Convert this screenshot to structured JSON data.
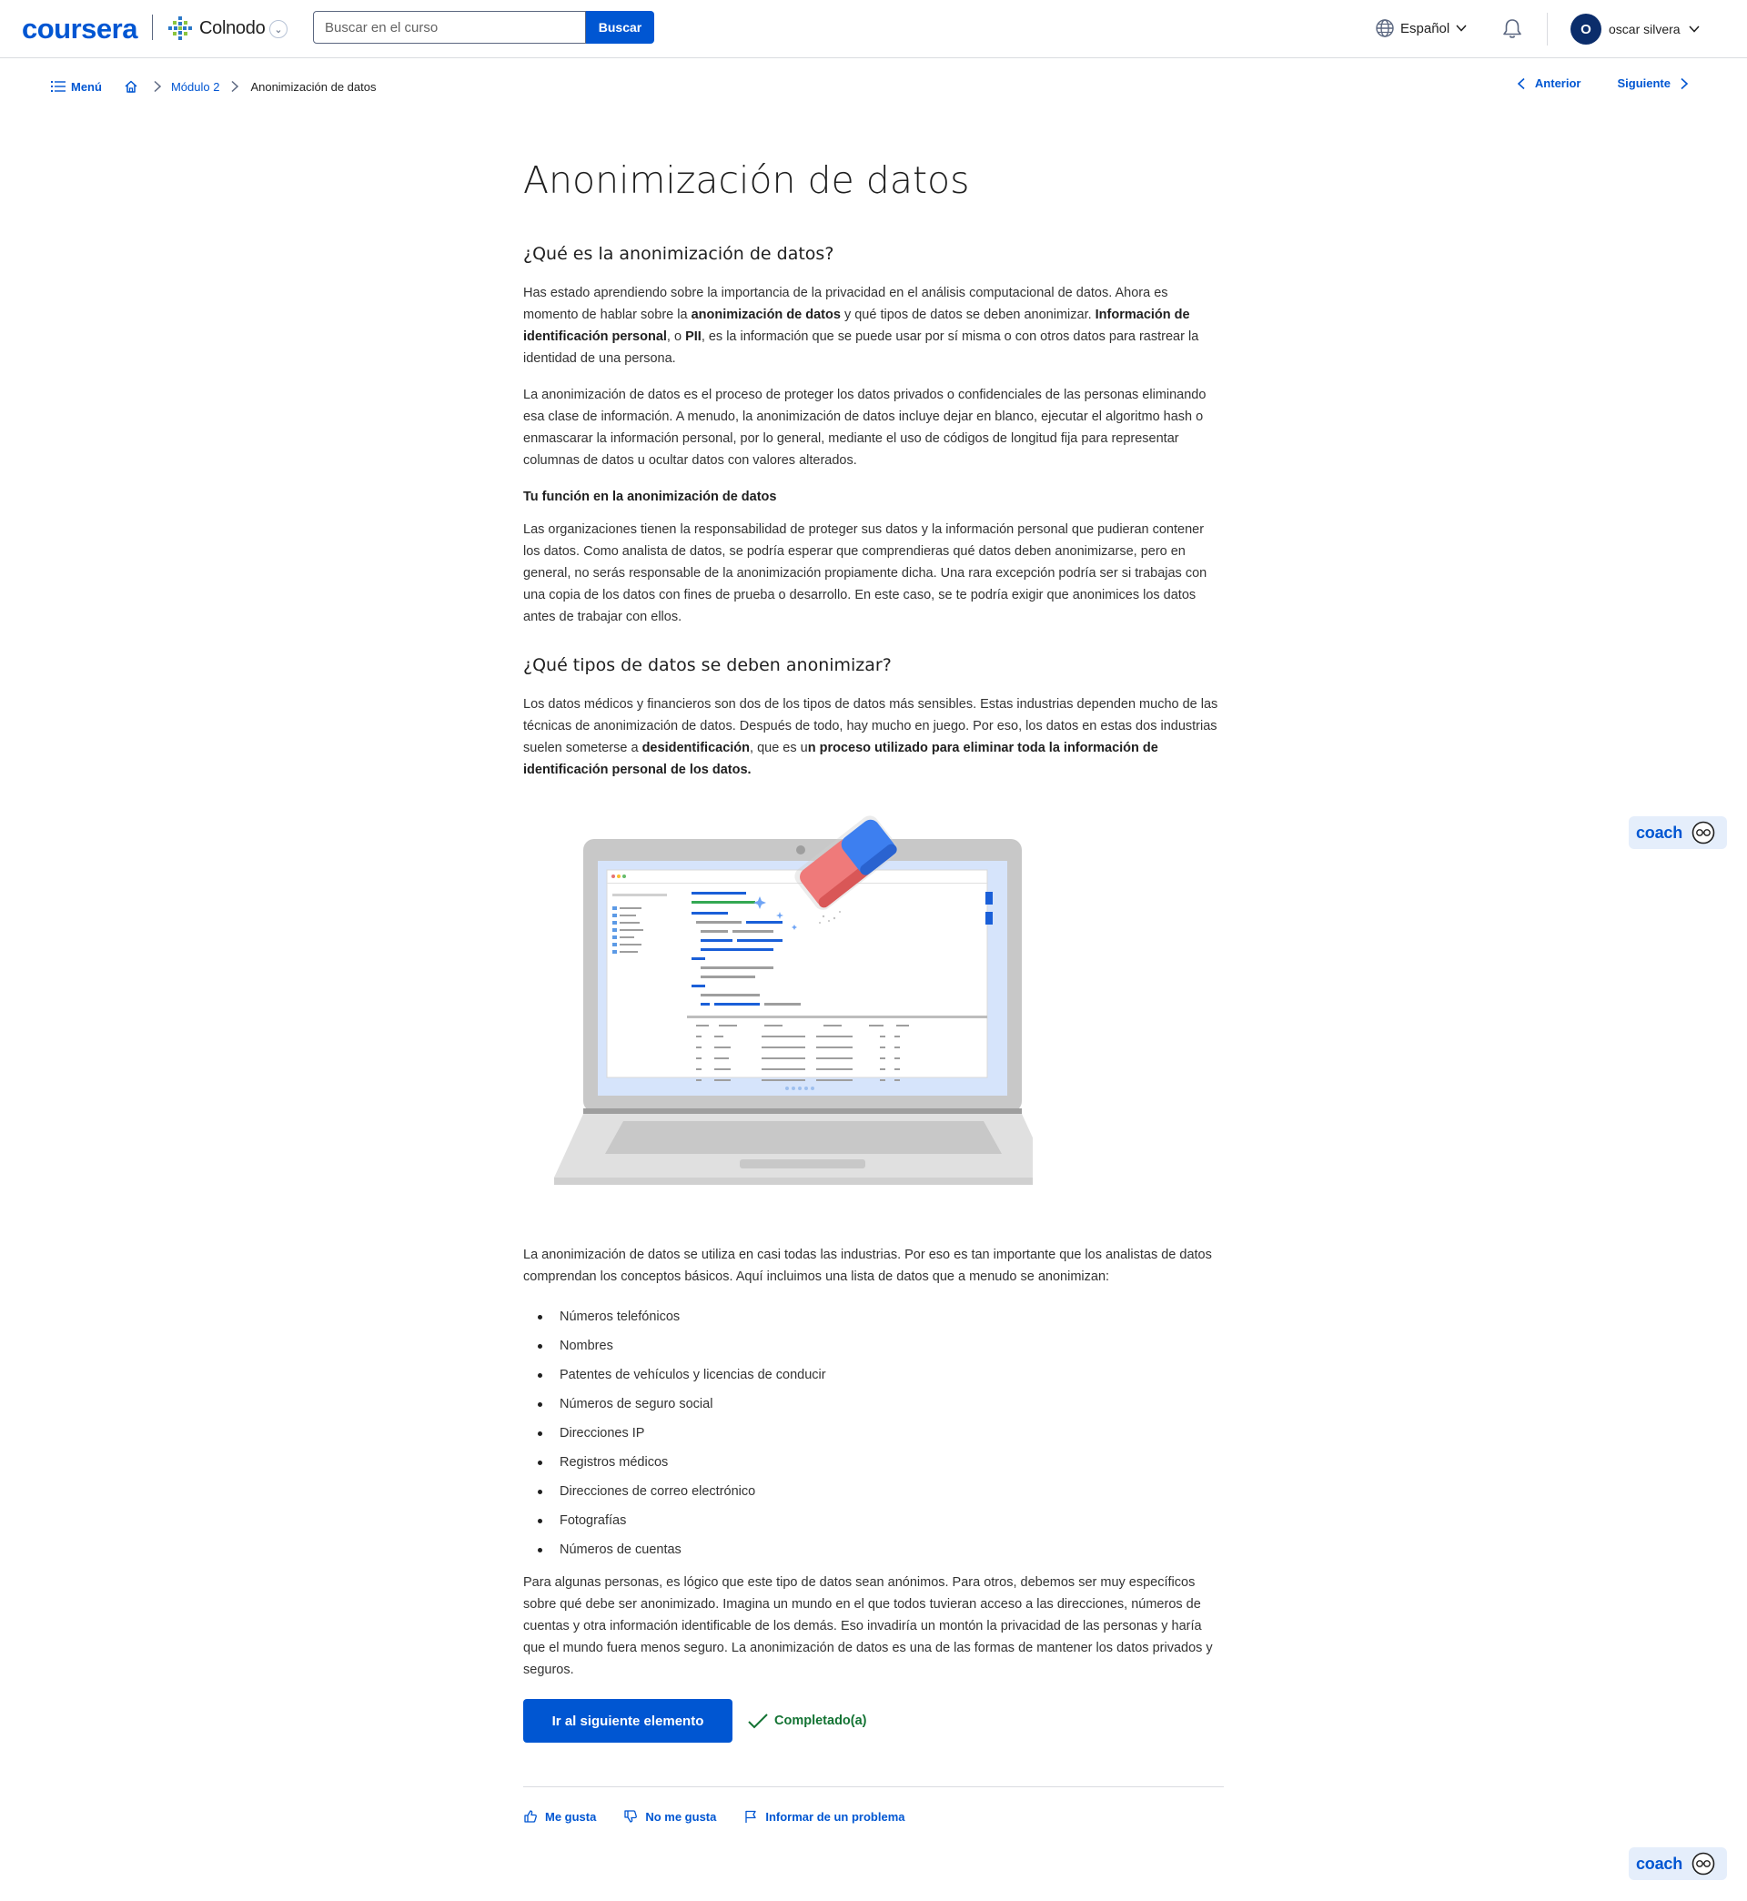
{
  "header": {
    "logo": "coursera",
    "partner": "Colnodo",
    "search_placeholder": "Buscar en el curso",
    "search_button": "Buscar",
    "language": "Español",
    "user_initial": "O",
    "user_name": "oscar silvera"
  },
  "breadcrumb": {
    "menu": "Menú",
    "module": "Módulo 2",
    "current": "Anonimización de datos",
    "prev": "Anterior",
    "next": "Siguiente"
  },
  "article": {
    "title": "Anonimización de datos",
    "h2_1": "¿Qué es la anonimización de datos?",
    "p1_a": "Has estado aprendiendo sobre la importancia de la privacidad en el análisis computacional de datos. Ahora es momento de hablar sobre la ",
    "p1_b": "anonimización de datos",
    "p1_c": " y qué tipos de datos se deben anonimizar. ",
    "p1_d": "Información de identificación personal",
    "p1_e": ", o ",
    "p1_f": "PII",
    "p1_g": ", es la información que se puede usar por sí misma o con otros datos para rastrear la identidad de una persona.",
    "p2": "La anonimización de datos es el proceso de proteger los datos privados o confidenciales de las personas eliminando esa clase de información. A menudo, la anonimización de datos incluye dejar en blanco, ejecutar el algoritmo hash o enmascarar la información personal, por lo general, mediante el uso de códigos de longitud fija para representar columnas de datos u ocultar datos con valores alterados.",
    "h3_1": "Tu función en la anonimización de datos",
    "p3": "Las organizaciones tienen la responsabilidad de proteger sus datos y la información personal que pudieran contener los datos. Como analista de datos, se podría esperar que comprendieras qué datos deben anonimizarse, pero en general, no serás responsable de la anonimización propiamente dicha. Una rara excepción podría ser si trabajas con una copia de los datos con fines de prueba o desarrollo. En este caso, se te podría exigir que anonimices los datos antes de trabajar con ellos.",
    "h2_2": "¿Qué tipos de datos se deben anonimizar?",
    "p4_a": "Los datos médicos y financieros son dos de los tipos de datos más sensibles. Estas industrias dependen mucho de las técnicas de anonimización de datos. Después de todo, hay mucho en juego. Por eso, los datos en estas dos industrias suelen someterse a ",
    "p4_b": "desidentificación",
    "p4_c": ", que es u",
    "p4_d": "n proceso utilizado para eliminar toda la información de identificación personal de los datos.",
    "p5": "La anonimización de datos se utiliza en casi todas las industrias. Por eso es tan importante que los analistas de datos comprendan los conceptos básicos. Aquí incluimos una lista de datos que a menudo se anonimizan:",
    "list": [
      "Números telefónicos",
      "Nombres",
      "Patentes de vehículos y licencias de conducir",
      "Números de seguro social",
      "Direcciones IP",
      "Registros médicos",
      "Direcciones de correo electrónico",
      "Fotografías",
      "Números de cuentas"
    ],
    "p6": "Para algunas personas, es lógico que este tipo de datos sean anónimos. Para otros, debemos ser muy específicos sobre qué debe ser anonimizado. Imagina un mundo en el que todos tuvieran acceso a las direcciones, números de cuentas y otra información identificable de los demás. Eso invadiría un montón la privacidad de las personas y haría que el mundo fuera menos seguro. La anonimización de datos es una de las formas de mantener los datos privados y seguros."
  },
  "actions": {
    "next_item": "Ir al siguiente elemento",
    "completed": "Completado(a)"
  },
  "feedback": {
    "like": "Me gusta",
    "dislike": "No me gusta",
    "report": "Informar de un problema"
  },
  "coach": {
    "label": "coach"
  },
  "colors": {
    "brand": "#0056d2",
    "success": "#137333",
    "text": "#1f1f1f"
  }
}
